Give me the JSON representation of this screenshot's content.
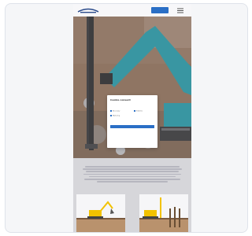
{
  "window": {
    "title": ""
  },
  "nav": {
    "cta_label": "",
    "logo": "company-logo",
    "menu_icon": "hamburger-menu-icon"
  },
  "hero": {
    "image": "excavator-drilling-photo"
  },
  "consent_modal": {
    "title": "Cookie consent",
    "body": "",
    "options": [
      {
        "label": "Necessary",
        "checked": true
      },
      {
        "label": "Statistics",
        "checked": false
      },
      {
        "label": "Marketing",
        "checked": false
      }
    ],
    "accept_label": "",
    "links": [
      "",
      ""
    ]
  },
  "content": {
    "heading": "",
    "illustrations": [
      "excavator-illustration",
      "pile-driving-illustration"
    ]
  },
  "colors": {
    "accent": "#2a6fc6",
    "excavator": "#17a7b8",
    "soil": "#8a7058"
  }
}
